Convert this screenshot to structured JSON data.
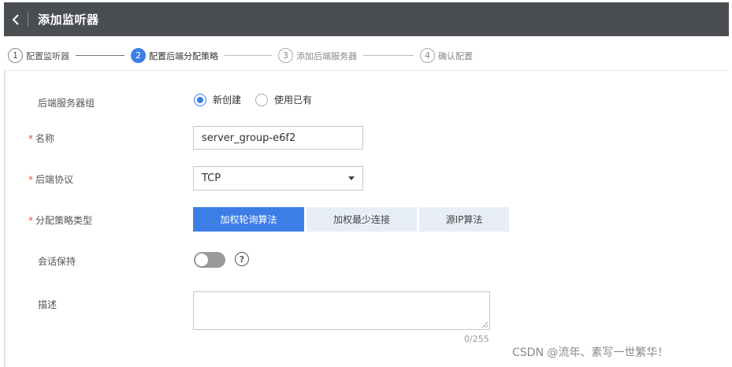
{
  "header": {
    "title": "添加监听器",
    "back_icon": "chevron-left-icon"
  },
  "steps": [
    {
      "num": "1",
      "label": "配置监听器",
      "state": "done"
    },
    {
      "num": "2",
      "label": "配置后端分配策略",
      "state": "active"
    },
    {
      "num": "3",
      "label": "添加后端服务器",
      "state": "todo"
    },
    {
      "num": "4",
      "label": "确认配置",
      "state": "todo"
    }
  ],
  "form": {
    "required_mark": "*",
    "server_group": {
      "label": "后端服务器组",
      "options": [
        "新创建",
        "使用已有"
      ],
      "selected": "新创建"
    },
    "name": {
      "label": "名称",
      "value": "server_group-e6f2"
    },
    "protocol": {
      "label": "后端协议",
      "value": "TCP"
    },
    "strategy": {
      "label": "分配策略类型",
      "options": [
        "加权轮询算法",
        "加权最少连接",
        "源IP算法"
      ],
      "selected": "加权轮询算法"
    },
    "session": {
      "label": "会话保持",
      "enabled": false,
      "help_glyph": "?"
    },
    "description": {
      "label": "描述",
      "value": "",
      "count": "0/255"
    }
  },
  "watermark": "CSDN @流年、素写一世繁华！",
  "colors": {
    "accent": "#3d7ee6",
    "header_bg": "#4a4d52",
    "required": "#e34c3c",
    "segment_bg": "#e8eef8"
  }
}
